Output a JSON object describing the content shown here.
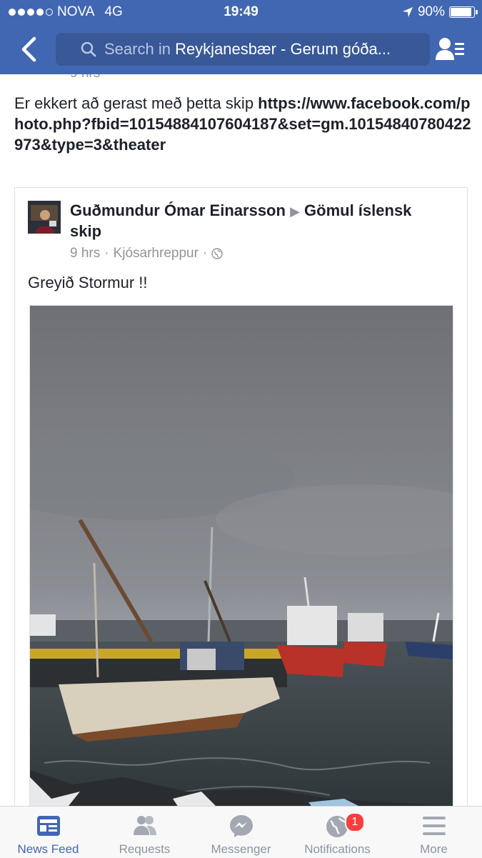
{
  "status_bar": {
    "carrier": "NOVA",
    "network": "4G",
    "time": "19:49",
    "battery": "90%",
    "battery_level": 0.9
  },
  "header": {
    "search_prefix": "Search in ",
    "search_group": "Reykjanesbær - Gerum góða...",
    "colors": {
      "bar": "#4267b2",
      "search_field": "#385898"
    }
  },
  "post": {
    "time": "9 hrs",
    "text": "Er ekkert að gerast með þetta skip ",
    "link": "https://www.facebook.com/photo.php?fbid=10154884107604187&set=gm.10154840780422973&type=3&theater"
  },
  "shared_post": {
    "author": "Guðmundur Ómar Einarsson",
    "arrow": "▶",
    "group": "Gömul íslensk skip",
    "time": "9 hrs",
    "location": "Kjósarhreppur",
    "separator": "·",
    "text": "Greyið Stormur !!",
    "privacy_icon": "globe-icon"
  },
  "tab_bar": {
    "tabs": [
      {
        "label": "News Feed",
        "icon": "news-feed-icon",
        "active": true
      },
      {
        "label": "Requests",
        "icon": "friends-icon",
        "active": false
      },
      {
        "label": "Messenger",
        "icon": "messenger-icon",
        "active": false
      },
      {
        "label": "Notifications",
        "icon": "globe-icon",
        "active": false,
        "badge": "1"
      },
      {
        "label": "More",
        "icon": "menu-icon",
        "active": false
      }
    ],
    "colors": {
      "active": "#4267b2",
      "inactive": "#8d949e",
      "badge": "#fa3e3e"
    }
  }
}
